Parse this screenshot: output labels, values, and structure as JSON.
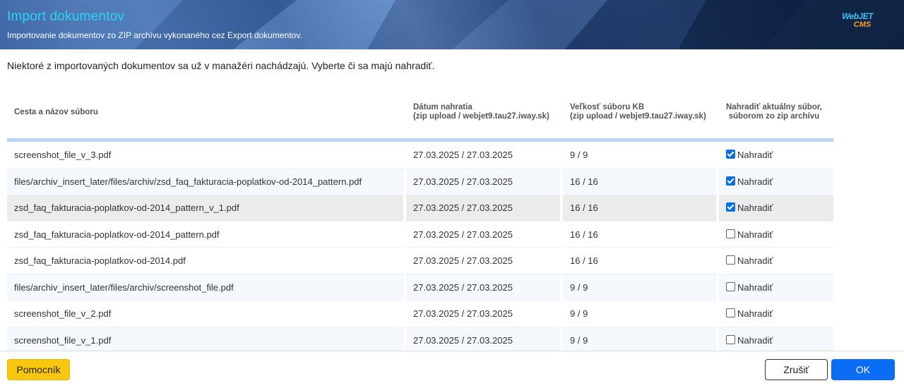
{
  "header": {
    "title": "Import dokumentov",
    "subtitle": "Importovanie dokumentov zo ZIP archívu vykonaného cez Export dokumentov.",
    "logo_line1": "WebJET",
    "logo_line2": "CMS"
  },
  "intro": "Niektoré z importovaných dokumentov sa už v manažéri nachádzajú. Vyberte či sa majú nahradiť.",
  "table": {
    "columns": [
      {
        "line1": "Cesta a názov súboru",
        "line2": ""
      },
      {
        "line1": "Dátum nahratia",
        "line2": "(zip upload / webjet9.tau27.iway.sk)"
      },
      {
        "line1": "Veľkosť súboru KB",
        "line2": "(zip upload / webjet9.tau27.iway.sk)"
      },
      {
        "line1": "Nahradiť aktuálny súbor,",
        "line2": "súborom zo zip archívu"
      }
    ],
    "rows": [
      {
        "path": "screenshot_file_v_3.pdf",
        "date": "27.03.2025 / 27.03.2025",
        "size": "9 / 9",
        "replace": true,
        "replace_label": "Nahradiť"
      },
      {
        "path": "files/archiv_insert_later/files/archiv/zsd_faq_fakturacia-poplatkov-od-2014_pattern.pdf",
        "date": "27.03.2025 / 27.03.2025",
        "size": "16 / 16",
        "replace": true,
        "replace_label": "Nahradiť"
      },
      {
        "path": "zsd_faq_fakturacia-poplatkov-od-2014_pattern_v_1.pdf",
        "date": "27.03.2025 / 27.03.2025",
        "size": "16 / 16",
        "replace": true,
        "replace_label": "Nahradiť"
      },
      {
        "path": "zsd_faq_fakturacia-poplatkov-od-2014_pattern.pdf",
        "date": "27.03.2025 / 27.03.2025",
        "size": "16 / 16",
        "replace": false,
        "replace_label": "Nahradiť"
      },
      {
        "path": "zsd_faq_fakturacia-poplatkov-od-2014.pdf",
        "date": "27.03.2025 / 27.03.2025",
        "size": "16 / 16",
        "replace": false,
        "replace_label": "Nahradiť"
      },
      {
        "path": "files/archiv_insert_later/files/archiv/screenshot_file.pdf",
        "date": "27.03.2025 / 27.03.2025",
        "size": "9 / 9",
        "replace": false,
        "replace_label": "Nahradiť"
      },
      {
        "path": "screenshot_file_v_2.pdf",
        "date": "27.03.2025 / 27.03.2025",
        "size": "9 / 9",
        "replace": false,
        "replace_label": "Nahradiť"
      },
      {
        "path": "screenshot_file_v_1.pdf",
        "date": "27.03.2025 / 27.03.2025",
        "size": "9 / 9",
        "replace": false,
        "replace_label": "Nahradiť"
      }
    ]
  },
  "footer": {
    "help_label": "Pomocník",
    "cancel_label": "Zrušiť",
    "ok_label": "OK"
  },
  "colors": {
    "title": "#2ad4f4",
    "ok_button": "#0b6cf5",
    "help_button": "#f9c80e",
    "checkbox_checked": "#0a6fe0"
  }
}
